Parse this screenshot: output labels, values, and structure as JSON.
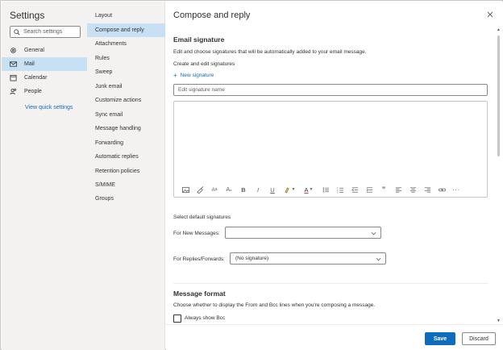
{
  "sidebar": {
    "title": "Settings",
    "search_placeholder": "Search settings",
    "items": [
      {
        "label": "General",
        "icon": "gear-icon"
      },
      {
        "label": "Mail",
        "icon": "mail-icon"
      },
      {
        "label": "Calendar",
        "icon": "calendar-icon"
      },
      {
        "label": "People",
        "icon": "people-icon"
      }
    ],
    "quick_settings_label": "View quick settings"
  },
  "mail_nav": {
    "items": [
      "Layout",
      "Compose and reply",
      "Attachments",
      "Rules",
      "Sweep",
      "Junk email",
      "Customize actions",
      "Sync email",
      "Message handling",
      "Forwarding",
      "Automatic replies",
      "Retention policies",
      "S/MIME",
      "Groups"
    ],
    "selected": "Compose and reply"
  },
  "main": {
    "title": "Compose and reply",
    "email_signature": {
      "heading": "Email signature",
      "description": "Edit and choose signatures that will be automatically added to your email message.",
      "subheading": "Create and edit signatures",
      "new_signature_label": "New signature",
      "name_placeholder": "Edit signature name",
      "toolbar_icons": [
        "image-icon",
        "format-painter-icon",
        "font-icon",
        "font-size-icon",
        "bold-icon",
        "italic-icon",
        "underline-icon",
        "highlight-icon",
        "font-color-icon",
        "bullets-icon",
        "numbering-icon",
        "decrease-indent-icon",
        "increase-indent-icon",
        "quote-icon",
        "align-left-icon",
        "align-center-icon",
        "align-right-icon",
        "link-icon",
        "more-icon"
      ]
    },
    "default_signatures": {
      "heading": "Select default signatures",
      "new_messages_label": "For New Messages:",
      "new_messages_value": "",
      "replies_label": "For Replies/Forwards:",
      "replies_value": "(No signature)"
    },
    "message_format": {
      "heading": "Message format",
      "description": "Choose whether to display the From and Bcc lines when you're composing a message.",
      "always_show_bcc_label": "Always show Bcc"
    }
  },
  "footer": {
    "save_label": "Save",
    "discard_label": "Discard"
  },
  "colors": {
    "accent": "#0f6cbd",
    "selected_bg": "#c7e0f4",
    "nav_bg": "#f3f2f1"
  }
}
